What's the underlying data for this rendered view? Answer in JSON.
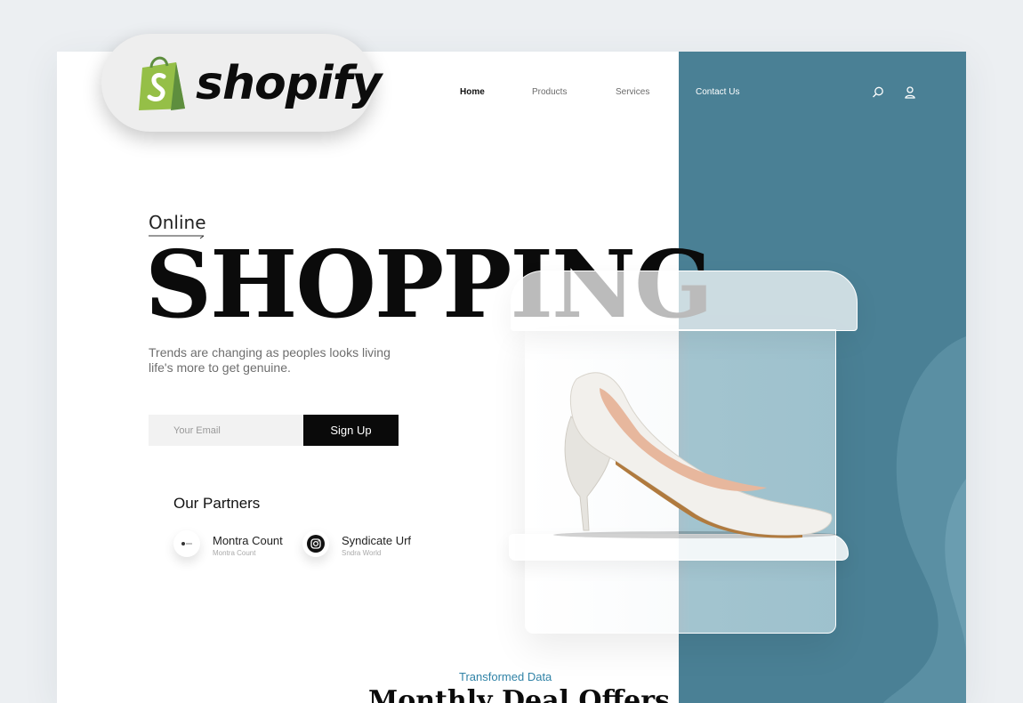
{
  "brand": {
    "name": "shopify",
    "bag_color": "#95bf47",
    "bag_dark": "#5e8e3e"
  },
  "nav": {
    "items": [
      {
        "label": "Home",
        "active": true
      },
      {
        "label": "Products",
        "active": false
      },
      {
        "label": "Services",
        "active": false
      },
      {
        "label": "Contact Us",
        "active": false
      }
    ],
    "icons": [
      "search-icon",
      "user-icon"
    ]
  },
  "hero": {
    "eyebrow": "Online",
    "title": "SHOPPING",
    "subtitle": "Trends are changing as peoples looks  living life's more to get genuine.",
    "email_placeholder": "Your Email",
    "signup_label": "Sign Up"
  },
  "partners": {
    "title": "Our Partners",
    "items": [
      {
        "name": "Montra Count",
        "sub": "Montra Count",
        "icon": "montra-logo-icon"
      },
      {
        "name": "Syndicate Urf",
        "sub": "Sndra World",
        "icon": "instagram-icon"
      }
    ]
  },
  "section": {
    "label": "Transformed Data",
    "title": "Monthly Deal Offers"
  },
  "colors": {
    "accent_teal": "#4a8095",
    "label_blue": "#2f82a6",
    "text_dark": "#0b0b0b"
  }
}
